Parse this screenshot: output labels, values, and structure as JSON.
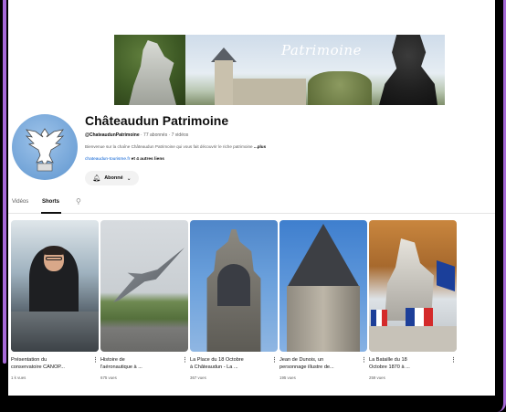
{
  "banner": {
    "title": "Patrimoine"
  },
  "channel": {
    "name": "Châteaudun Patrimoine",
    "handle": "@ChateaudunPatrimoine",
    "stats": "· 77 abonnés · 7 vidéos",
    "description": "Bienvenue sur la chaîne Châteaudun Patrimoine qui vous fait découvrir le riche patrimoine",
    "more_label": "...plus",
    "link": "chateaudun-tourisme.fr",
    "other_links": "et 4 autres liens",
    "subscribe_label": "Abonné"
  },
  "tabs": [
    {
      "label": "Vidéos",
      "active": false
    },
    {
      "label": "Shorts",
      "active": true
    }
  ],
  "shorts": [
    {
      "title": "Présentation du\nconservatoire CANOP...",
      "views": "1 k vues"
    },
    {
      "title": "Histoire de\nl'aéronautique à ...",
      "views": "675 vues"
    },
    {
      "title": "La Place du 18 Octobre\nà Châteaudun - La ...",
      "views": "367 vues"
    },
    {
      "title": "Jean de Dunois, un\npersonnage illustre de...",
      "views": "195 vues"
    },
    {
      "title": "La Bataille du 18\nOctobre 1870 à ...",
      "views": "259 vues"
    }
  ],
  "colors": {
    "accent": "#a66ad8",
    "link": "#065fd4",
    "text": "#0f0f0f",
    "meta": "#606060"
  },
  "icons": {
    "bell": "bell-icon",
    "chevron": "chevron-down-icon",
    "search": "search-icon",
    "menu": "more-vertical-icon"
  }
}
